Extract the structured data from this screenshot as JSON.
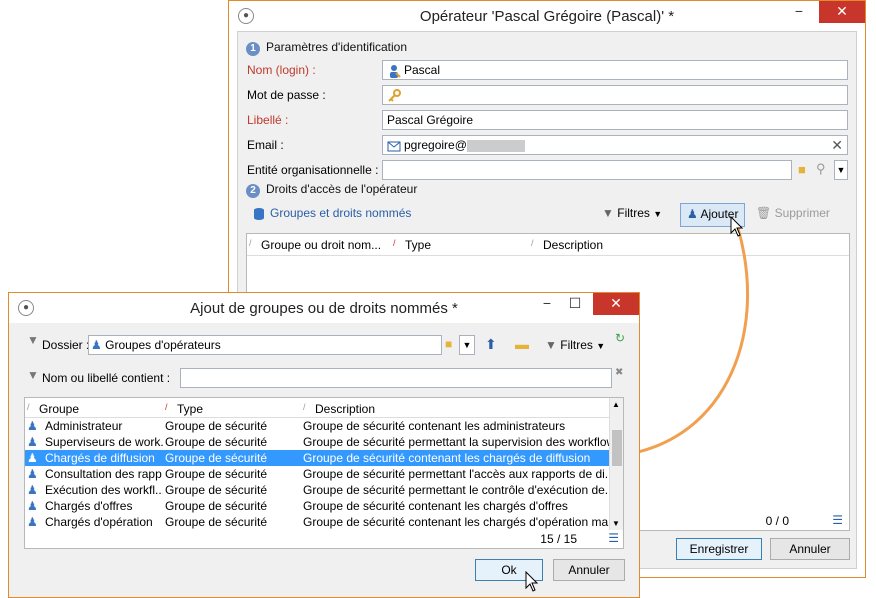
{
  "main": {
    "title": "Opérateur 'Pascal Grégoire (Pascal)' *",
    "minimize": "−",
    "close": "✕",
    "section1": "Paramètres d'identification",
    "section1_num": "1",
    "fields": {
      "login_label": "Nom (login) :",
      "login_value": "Pascal",
      "password_label": "Mot de passe :",
      "libelle_label": "Libellé :",
      "libelle_value": "Pascal Grégoire",
      "email_label": "Email :",
      "email_value": "pgregoire@",
      "entity_label": "Entité organisationnelle :"
    },
    "section2": "Droits d'accès de l'opérateur",
    "section2_num": "2",
    "toolbar": {
      "groups_link": "Groupes et droits nommés",
      "filters": "Filtres",
      "add": "Ajouter",
      "delete": "Supprimer"
    },
    "grid": {
      "col1": "Groupe ou droit nom...",
      "col2": "Type",
      "col3": "Description",
      "count": "0 / 0"
    },
    "buttons": {
      "save": "Enregistrer",
      "cancel": "Annuler"
    }
  },
  "dialog": {
    "title": "Ajout de groupes ou de droits nommés *",
    "minimize": "−",
    "maximize": "☐",
    "close": "✕",
    "folder_label": "Dossier :",
    "folder_value": "Groupes d'opérateurs",
    "filters": "Filtres",
    "name_filter_label": "Nom ou libellé contient :",
    "columns": {
      "group": "Groupe",
      "type": "Type",
      "description": "Description"
    },
    "rows": [
      {
        "group": "Administrateur",
        "type": "Groupe de sécurité",
        "description": "Groupe de sécurité contenant les administrateurs"
      },
      {
        "group": "Superviseurs de work...",
        "type": "Groupe de sécurité",
        "description": "Groupe de sécurité permettant la supervision des workflow"
      },
      {
        "group": "Chargés de diffusion",
        "type": "Groupe de sécurité",
        "description": "Groupe de sécurité contenant les chargés de diffusion"
      },
      {
        "group": "Consultation des rapp",
        "type": "Groupe de sécurité",
        "description": "Groupe de sécurité permettant l'accès aux rapports de di..."
      },
      {
        "group": "Exécution des workfl...",
        "type": "Groupe de sécurité",
        "description": "Groupe de sécurité permettant le contrôle d'exécution de..."
      },
      {
        "group": "Chargés d'offres",
        "type": "Groupe de sécurité",
        "description": "Groupe de sécurité contenant les chargés d'offres"
      },
      {
        "group": "Chargés d'opération",
        "type": "Groupe de sécurité",
        "description": "Groupe de sécurité contenant les chargés d'opération ma..."
      }
    ],
    "selected_row": 2,
    "count": "15 / 15",
    "buttons": {
      "ok": "Ok",
      "cancel": "Annuler"
    }
  },
  "colors": {
    "accent_border": "#e58a2b",
    "selection": "#3399ff",
    "close_red": "#c7352b",
    "required": "#c0392b"
  }
}
